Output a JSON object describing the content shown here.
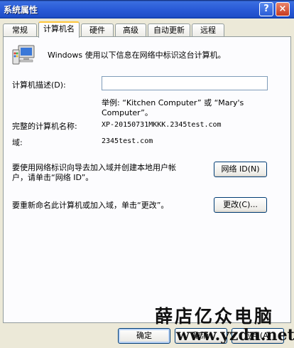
{
  "window": {
    "title": "系统属性",
    "help_label": "?",
    "close_label": "×"
  },
  "tabs": [
    {
      "label": "常规"
    },
    {
      "label": "计算机名"
    },
    {
      "label": "硬件"
    },
    {
      "label": "高级"
    },
    {
      "label": "自动更新"
    },
    {
      "label": "远程"
    }
  ],
  "computer_name": {
    "intro": "Windows 使用以下信息在网络中标识这台计算机。",
    "description_label": "计算机描述(D):",
    "description_value": "",
    "example_line1": "举例: “Kitchen Computer” 或 “Mary's",
    "example_line2": "Computer”。",
    "full_name_label": "完整的计算机名称:",
    "full_name_value": "XP-20150731MKKK.2345test.com",
    "domain_label": "域:",
    "domain_value": "2345test.com",
    "network_id_text_line1": "要使用网络标识向导去加入域并创建本地用户帐",
    "network_id_text_line2": "户，请单击“网络 ID”。",
    "network_id_button": "网络 ID(N)",
    "rename_text": "要重新命名此计算机或加入域，单击“更改”。",
    "change_button": "更改(C)..."
  },
  "footer": {
    "ok_button": "确定",
    "cancel_button": "取消",
    "apply_button": "应用(A)"
  },
  "watermark": {
    "cn_text": "薛店亿众电脑",
    "url": "www.yzdn.net"
  }
}
